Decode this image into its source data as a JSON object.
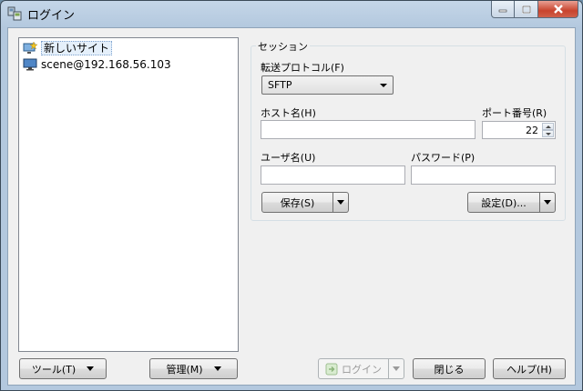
{
  "window": {
    "title": "ログイン"
  },
  "tree": {
    "items": [
      {
        "label": "新しいサイト",
        "icon": "new-site-icon",
        "selected": true
      },
      {
        "label": "scene@192.168.56.103",
        "icon": "monitor-icon",
        "selected": false
      }
    ]
  },
  "session": {
    "group_title": "セッション",
    "protocol_label": "転送プロトコル(F)",
    "protocol_value": "SFTP",
    "host_label": "ホスト名(H)",
    "host_value": "",
    "port_label": "ポート番号(R)",
    "port_value": "22",
    "user_label": "ユーザ名(U)",
    "user_value": "",
    "password_label": "パスワード(P)",
    "password_value": "",
    "save_button": "保存(S)",
    "settings_button": "設定(D)..."
  },
  "footer": {
    "tools_button": "ツール(T)",
    "manage_button": "管理(M)",
    "login_button": "ログイン",
    "close_button": "閉じる",
    "help_button": "ヘルプ(H)"
  }
}
